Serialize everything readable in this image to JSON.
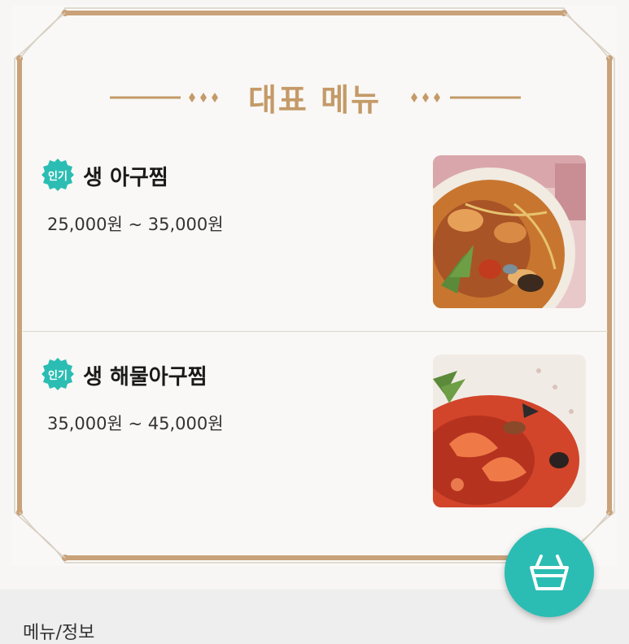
{
  "section": {
    "title": "대표 메뉴"
  },
  "menu_items": [
    {
      "badge": "인기",
      "name": "생 아구찜",
      "price": "25,000원 ~ 35,000원",
      "image": "braised-monkfish-photo"
    },
    {
      "badge": "인기",
      "name": "생 해물아구찜",
      "price": "35,000원 ~ 45,000원",
      "image": "braised-seafood-monkfish-photo"
    }
  ],
  "cart": {
    "icon": "basket-icon"
  },
  "bottom": {
    "text": "메뉴/정보"
  },
  "colors": {
    "accent_gold": "#c49a68",
    "badge_teal": "#2bbdb3",
    "cart_teal": "#2bbdb3"
  }
}
